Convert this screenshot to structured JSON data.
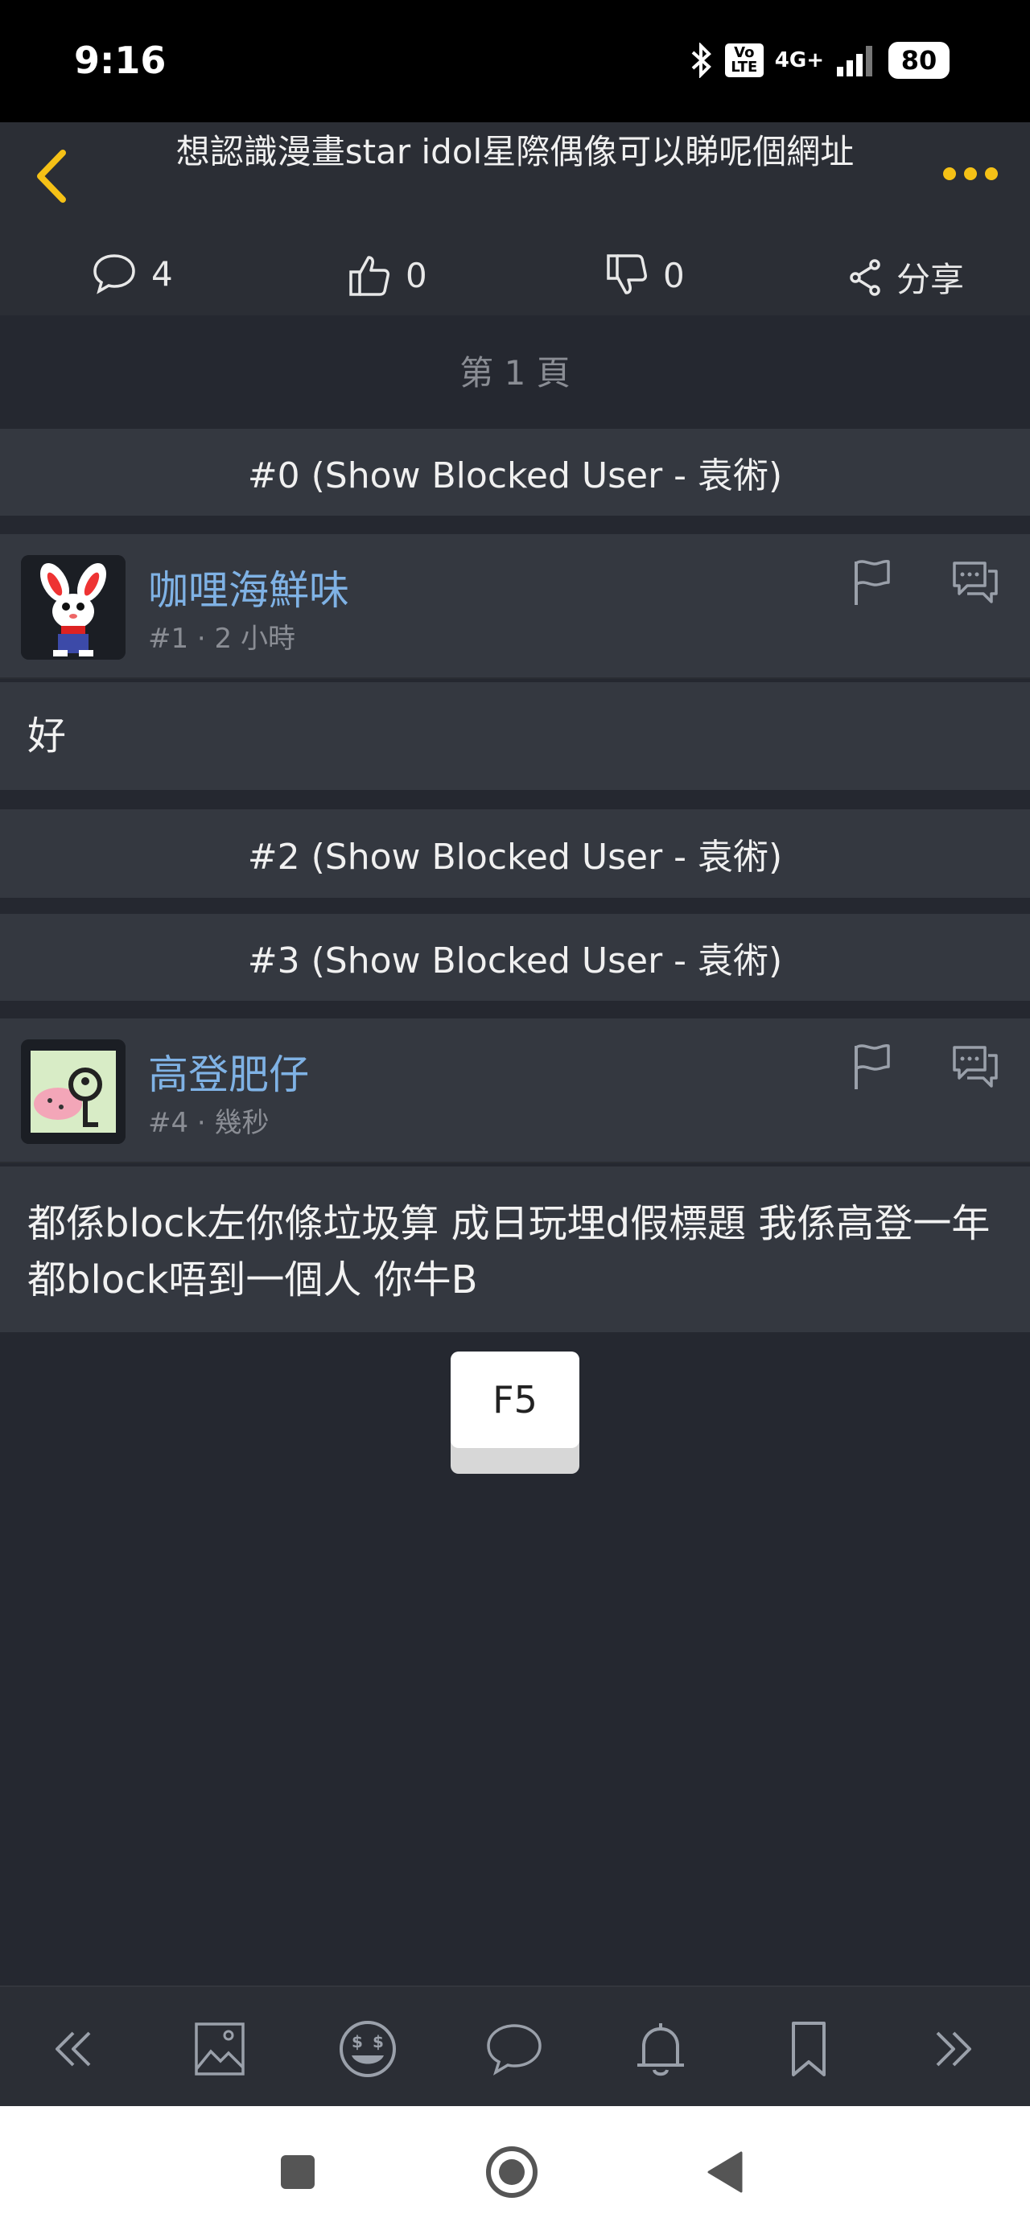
{
  "status_bar": {
    "time": "9:16",
    "network_label": "4G+",
    "volte_label": "Vo LTE",
    "battery": "80"
  },
  "header": {
    "title": "想認識漫畫star idol星際偶像可以睇呢個網址",
    "accent_color": "#f5c116"
  },
  "actions": {
    "comments": "4",
    "likes": "0",
    "dislikes": "0",
    "share_label": "分享"
  },
  "page_label": "第 1 頁",
  "blocked": {
    "b0": "#0 (Show Blocked User - 袁術)",
    "b2": "#2 (Show Blocked User - 袁術)",
    "b3": "#3 (Show Blocked User - 袁術)"
  },
  "posts": [
    {
      "username": "咖哩海鮮味",
      "meta": "#1 · 2 小時",
      "body": "好"
    },
    {
      "username": "高登肥仔",
      "meta": "#4 · 幾秒",
      "body": "都係block左你條垃圾算 成日玩埋d假標題 我係高登一年都block唔到一個人 你牛B"
    }
  ],
  "refresh_key": "F5",
  "colors": {
    "background": "#252830",
    "card": "#343840",
    "username": "#7fb2e5"
  }
}
